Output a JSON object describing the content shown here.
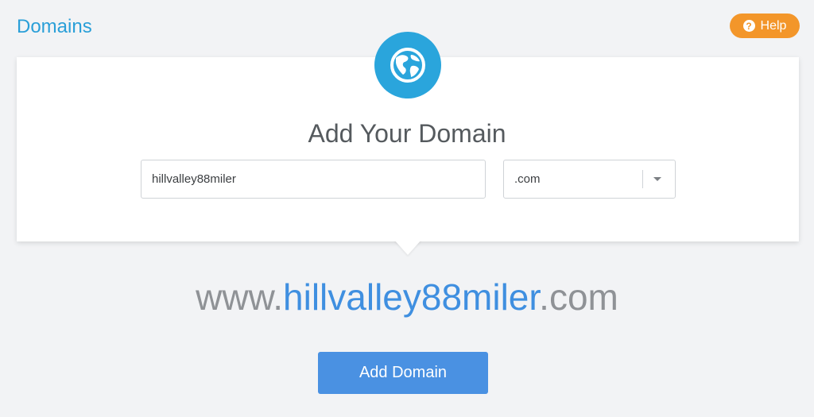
{
  "header": {
    "title": "Domains",
    "help_label": "Help",
    "help_icon_glyph": "?"
  },
  "card": {
    "icon": "globe-icon",
    "heading": "Add Your Domain",
    "domain_input": {
      "value": "hillvalley88miler",
      "placeholder": ""
    },
    "tld_select": {
      "selected": ".com",
      "icon": "chevron-down-icon"
    }
  },
  "preview": {
    "prefix": "www.",
    "name": "hillvalley88miler",
    "suffix": ".com"
  },
  "actions": {
    "add_domain_label": "Add Domain"
  },
  "colors": {
    "background": "#f2f3f5",
    "title_blue": "#2a9fd8",
    "help_orange": "#f3962a",
    "globe_blue": "#2aa5dc",
    "preview_name_blue": "#3f8fe0",
    "preview_gray": "#8f9296",
    "button_blue": "#4a91e2"
  }
}
